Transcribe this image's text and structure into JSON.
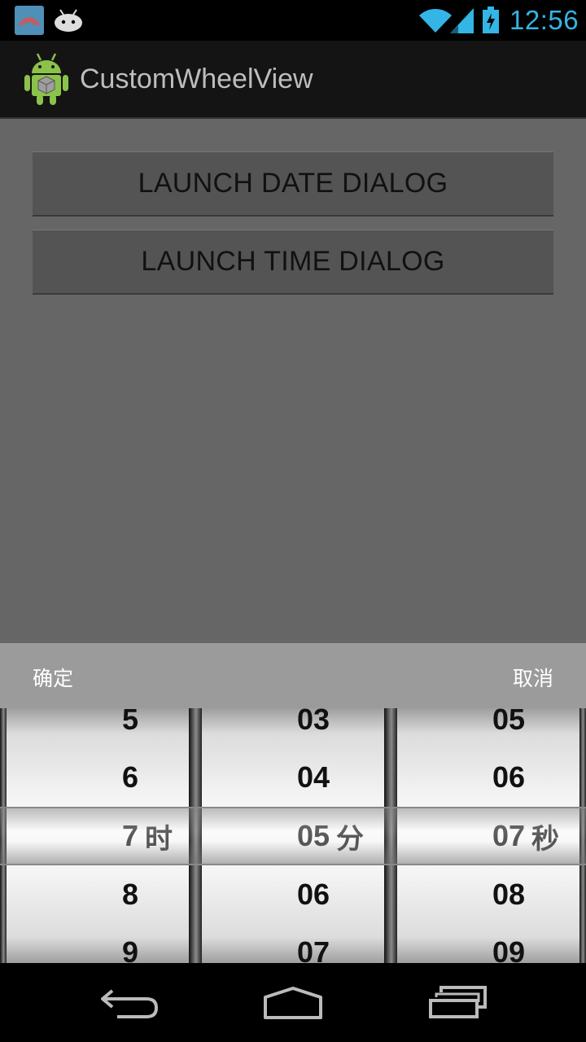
{
  "status_bar": {
    "time": "12:56",
    "icons": [
      "notification-app-icon",
      "android-debug-icon",
      "wifi-icon",
      "signal-icon",
      "battery-charging-icon"
    ]
  },
  "action_bar": {
    "title": "CustomWheelView",
    "icon": "android-app-icon"
  },
  "content": {
    "launch_date_label": "LAUNCH DATE DIALOG",
    "launch_time_label": "LAUNCH TIME DIALOG"
  },
  "picker": {
    "confirm_label": "确定",
    "cancel_label": "取消",
    "hours": {
      "items": [
        "5",
        "6",
        "7",
        "8",
        "9"
      ],
      "selected": "7",
      "unit": "时"
    },
    "minutes": {
      "items": [
        "03",
        "04",
        "05",
        "06",
        "07"
      ],
      "selected": "05",
      "unit": "分"
    },
    "seconds": {
      "items": [
        "05",
        "06",
        "07",
        "08",
        "09"
      ],
      "selected": "07",
      "unit": "秒"
    }
  },
  "nav_bar": {
    "icons": [
      "back-icon",
      "home-icon",
      "recent-apps-icon"
    ]
  },
  "colors": {
    "status_time": "#33b5e5",
    "content_bg": "#666666",
    "button_bg": "#545454",
    "picker_bar_bg": "#9b9b9b"
  }
}
